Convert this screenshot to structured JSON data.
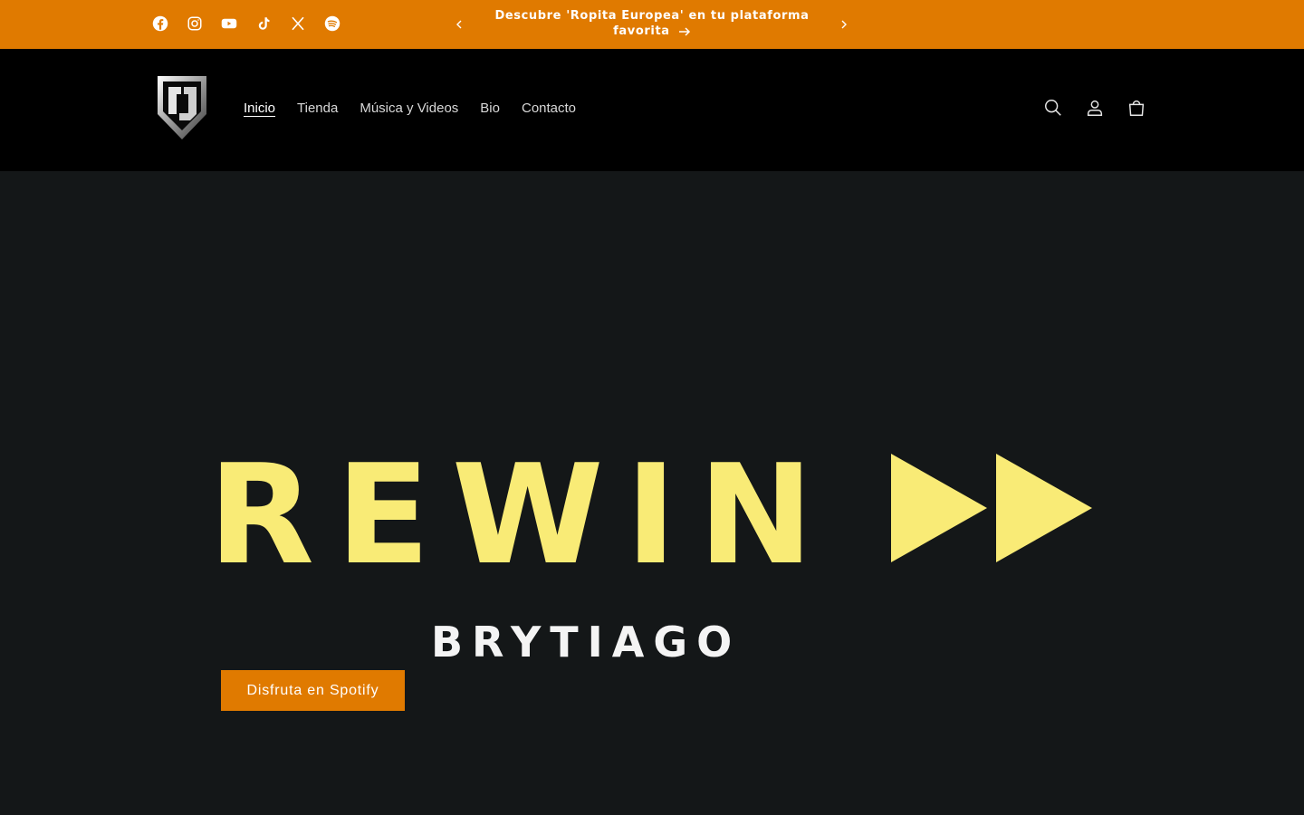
{
  "announcement": {
    "message": "Descubre 'Ropita Europea' en tu plataforma favorita",
    "prev_icon": "chevron-left-icon",
    "next_icon": "chevron-right-icon",
    "link_icon": "arrow-right-icon"
  },
  "socials": [
    "facebook-icon",
    "instagram-icon",
    "youtube-icon",
    "tiktok-icon",
    "x-icon",
    "spotify-icon"
  ],
  "header": {
    "logo": "brand-shield-logo",
    "nav": [
      {
        "label": "Inicio",
        "active": true
      },
      {
        "label": "Tienda"
      },
      {
        "label": "Música y Videos"
      },
      {
        "label": "Bio"
      },
      {
        "label": "Contacto"
      }
    ],
    "icons": [
      "search-icon",
      "account-icon",
      "cart-icon"
    ]
  },
  "hero": {
    "title": "REWIN",
    "artist": "BRYTIAGO",
    "cta_label": "Disfruta en Spotify"
  },
  "colors": {
    "accent": "#e07a00",
    "header_bg": "#000000",
    "hero_bg": "#141718",
    "title_yellow": "#f9eb76"
  }
}
